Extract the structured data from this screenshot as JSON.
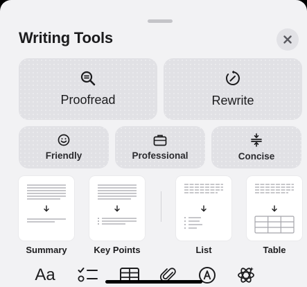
{
  "sheet": {
    "title": "Writing Tools"
  },
  "actions": {
    "proofread": "Proofread",
    "rewrite": "Rewrite"
  },
  "tones": [
    {
      "label": "Friendly",
      "icon": "smiley-icon"
    },
    {
      "label": "Professional",
      "icon": "briefcase-icon"
    },
    {
      "label": "Concise",
      "icon": "compress-icon"
    }
  ],
  "formats": [
    {
      "label": "Summary"
    },
    {
      "label": "Key Points"
    },
    {
      "label": "List"
    },
    {
      "label": "Table"
    }
  ],
  "toolbar": {
    "text_format": "Aa",
    "icons": [
      "text-format-icon",
      "checklist-icon",
      "table-icon",
      "paperclip-icon",
      "markup-icon",
      "apple-intelligence-icon"
    ]
  },
  "colors": {
    "sheet_bg": "#f2f2f4",
    "button_bg": "#e1e1e5",
    "text": "#1c1c1e",
    "thumb_line": "#9a9aa0"
  }
}
